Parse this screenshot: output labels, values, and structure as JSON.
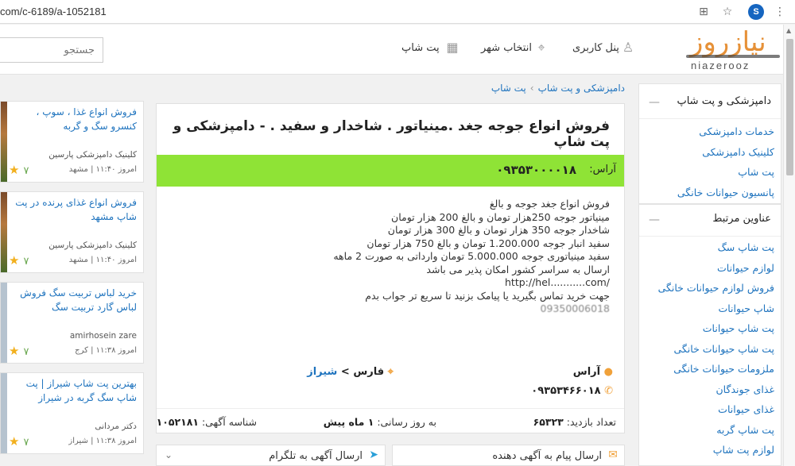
{
  "browser": {
    "url": "com/c-6189/a-1052181",
    "avatar_letter": "S"
  },
  "header": {
    "search_placeholder": "جستجو",
    "nav_user_panel": "پنل کاربری",
    "nav_select_city": "انتخاب شهر",
    "nav_pet_shop": "پت شاپ",
    "logo_fa": "نیازروز",
    "logo_en": "niazerooz"
  },
  "breadcrumb": {
    "item1": "دامپزشکی و پت شاپ",
    "sep": "›",
    "item2": "پت شاپ"
  },
  "sidebar": {
    "category_title": "دامپزشکی و پت شاپ",
    "category_links": [
      "خدمات دامپزشکی",
      "کلینیک دامپزشکی",
      "پت شاپ",
      "پانسیون حیوانات خانگی"
    ],
    "related_title": "عناوین مرتبط",
    "related_links": [
      "پت شاپ سگ",
      "لوازم حیوانات",
      "فروش لوازم حیوانات خانگی",
      "شاپ حیوانات",
      "پت شاپ حیوانات",
      "پت شاپ حیوانات خانگی",
      "ملزومات حیوانات خانگی",
      "غذای جوندگان",
      "غذای حیوانات",
      "پت شاپ گربه",
      "لوازم پت شاپ"
    ]
  },
  "ad": {
    "title": "فروش انواع جوجه جغد .مینیاتور . شاخدار و سفید . - دامپزشکی و پت شاپ",
    "seller_label": "آراس:",
    "seller_phone": "۰۹۳۵۳۰۰۰۰۱۸",
    "body_lines": [
      "فروش انواع جغد جوجه و بالغ",
      "مینیاتور جوجه 250هزار تومان و بالغ 200 هزار تومان",
      "شاخدار جوجه 350 هزار تومان و بالغ 300 هزار تومان",
      "سفید انبار جوجه 1.200.000 تومان و بالغ 750 هزار تومان",
      "سفید مینیاتوری جوجه 5.000.000 تومان وارداتی به صورت 2 ماهه",
      "ارسال به سراسر کشور امکان پذیر می باشد",
      "http://hel...........com/",
      "جهت خرید تماس بگیرید یا پیامک بزنید تا سریع تر جواب بدم",
      "09350006018"
    ],
    "seller_name": "آراس",
    "location_province": "فارس",
    "location_sep": ">",
    "location_city": "شیراز",
    "phone2": "۰۹۳۵۳۴۶۶۰۱۸",
    "visits_label": "تعداد بازدید:",
    "visits_value": "۶۵۳۲۳",
    "updated_label": "به روز رسانی:",
    "updated_value": "۱ ماه پیش",
    "ad_id_label": "شناسه آگهی:",
    "ad_id_value": "۱۰۵۲۱۸۱"
  },
  "buttons": {
    "message_advertiser": "ارسال پیام به آگهی دهنده",
    "send_telegram": "ارسال آگهی به تلگرام"
  },
  "related_ads": [
    {
      "title": "فروش انواع غذا ، سوپ ، کنسرو سگ و گربه",
      "clinic": "کلینیک دامپزشکی پارسین",
      "meta": "امروز ۱۱:۴۰ | مشهد",
      "rating": "۷"
    },
    {
      "title": "فروش انواع غذای پرنده در پت شاپ مشهد",
      "clinic": "کلینیک دامپزشکی پارسین",
      "meta": "امروز ۱۱:۴۰ | مشهد",
      "rating": "۷"
    },
    {
      "title": "خرید لباس تربیت سگ فروش لباس گارد تربیت سگ",
      "clinic": "amirhosein zare",
      "meta": "امروز ۱۱:۳۸ | کرج",
      "rating": "۷"
    },
    {
      "title": "بهترین پت شاپ شیراز | پت شاپ سگ گربه در شیراز",
      "clinic": "دکتر مردانی",
      "meta": "امروز ۱۱:۳۸ | شیراز",
      "rating": "۷"
    }
  ],
  "colors": {
    "accent_green": "#8fe336",
    "link_blue": "#1e73be",
    "logo_orange": "#e69138",
    "star_gold": "#f2b01e"
  }
}
